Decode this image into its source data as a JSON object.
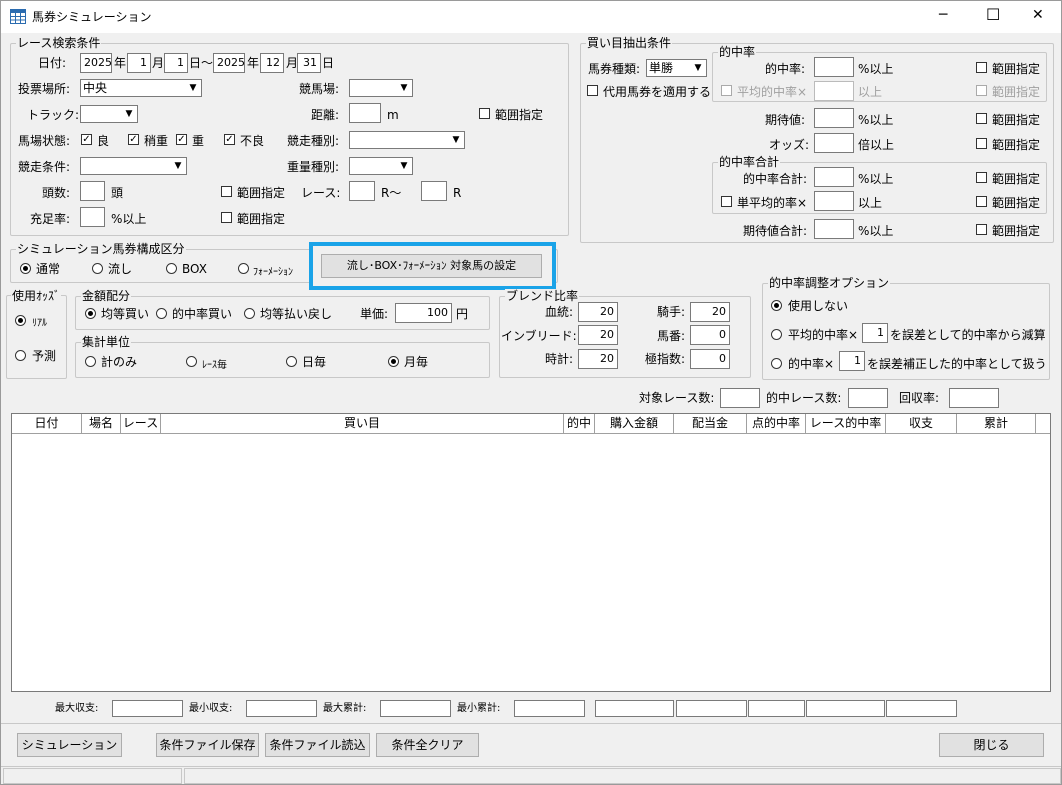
{
  "window": {
    "title": "馬券シミュレーション",
    "min": "─",
    "max": "☐",
    "close": "✕"
  },
  "race": {
    "group": "レース検索条件",
    "date_label": "日付:",
    "from": {
      "year": "2025",
      "month": "1",
      "day": "1"
    },
    "to": {
      "year": "2025",
      "month": "12",
      "day": "31"
    },
    "u_year": "年",
    "u_month": "月",
    "u_day_tilde": "日～",
    "u_day": "日",
    "venue_label": "投票場所:",
    "venue": "中央",
    "course_label": "競馬場:",
    "course": "",
    "track_label": "トラック:",
    "track": "",
    "distance_label": "距離:",
    "distance": "",
    "distance_unit": "m",
    "range": "範囲指定",
    "cond_label": "馬場状態:",
    "conds": [
      "良",
      "稍重",
      "重",
      "不良"
    ],
    "type_label": "競走種別:",
    "type": "",
    "race_cond_label": "競走条件:",
    "race_cond": "",
    "weight_label": "重量種別:",
    "weight": "",
    "heads_label": "頭数:",
    "heads": "",
    "heads_unit": "頭",
    "race_label": "レース:",
    "race_from": "",
    "race_unit1": "R～",
    "race_to": "",
    "race_unit2": "R",
    "fill_label": "充足率:",
    "fill": "",
    "fill_unit": "%以上"
  },
  "buy": {
    "group": "買い目抽出条件",
    "kind_label": "馬券種類:",
    "kind": "単勝",
    "substitute": "代用馬券を適用する",
    "hit_group": "的中率",
    "hit_label": "的中率:",
    "hit": "",
    "pct_over": "%以上",
    "avg_hit_label": "平均的中率×",
    "avg_hit": "",
    "over": "以上",
    "ev_label": "期待値:",
    "ev": "",
    "odds_label": "オッズ:",
    "odds": "",
    "odds_unit": "倍以上",
    "total_group": "的中率合計",
    "total_hit_label": "的中率合計:",
    "total_hit": "",
    "single_avg_label": "単平均的率×",
    "single_avg": "",
    "ev_total_label": "期待値合計:",
    "ev_total": "",
    "range": "範囲指定"
  },
  "sim": {
    "group": "シミュレーション馬券構成区分",
    "options": [
      "通常",
      "流し",
      "BOX",
      "ﾌｫｰﾒｰｼｮﾝ"
    ],
    "target_button": "流し･BOX･ﾌｫｰﾒｰｼｮﾝ 対象馬の設定",
    "highlight": "#1aa3e8"
  },
  "odds": {
    "group": "使用ｵｯｽﾞ",
    "options": [
      "ﾘｱﾙ",
      "予測"
    ]
  },
  "amount": {
    "group": "金額配分",
    "options": [
      "均等買い",
      "的中率買い",
      "均等払い戻し"
    ],
    "unit_label": "単価:",
    "unit": "100",
    "yen": "円"
  },
  "agg": {
    "group": "集計単位",
    "options": [
      "計のみ",
      "ﾚｰｽ毎",
      "日毎",
      "月毎"
    ]
  },
  "blend": {
    "group": "ブレンド比率",
    "blood_label": "血統:",
    "blood": "20",
    "jockey_label": "騎手:",
    "jockey": "20",
    "inbreed_label": "インブリード:",
    "inbreed": "20",
    "number_label": "馬番:",
    "number": "0",
    "clock_label": "時計:",
    "clock": "20",
    "index_label": "極指数:",
    "index": "0"
  },
  "adjust": {
    "group": "的中率調整オプション",
    "none": "使用しない",
    "opt1_pre": "平均的中率×",
    "opt1_val": "1",
    "opt1_post": "を誤差として的中率から減算",
    "opt2_pre": "的中率×",
    "opt2_val": "1",
    "opt2_post": "を誤差補正した的中率として扱う"
  },
  "stats": {
    "target_label": "対象レース数:",
    "target": "",
    "hit_label": "的中レース数:",
    "hit": "",
    "rate_label": "回収率:",
    "rate": ""
  },
  "table": {
    "columns": [
      "日付",
      "場名",
      "レース",
      "買い目",
      "的中",
      "購入金額",
      "配当金",
      "点的中率",
      "レース的中率",
      "収支",
      "累計"
    ]
  },
  "summary": {
    "max_label": "最大収支:",
    "min_label": "最小収支:",
    "max_cum_label": "最大累計:",
    "min_cum_label": "最小累計:"
  },
  "buttons": {
    "simulate": "シミュレーション",
    "save": "条件ファイル保存",
    "load": "条件ファイル読込",
    "clear": "条件全クリア",
    "close": "閉じる"
  }
}
